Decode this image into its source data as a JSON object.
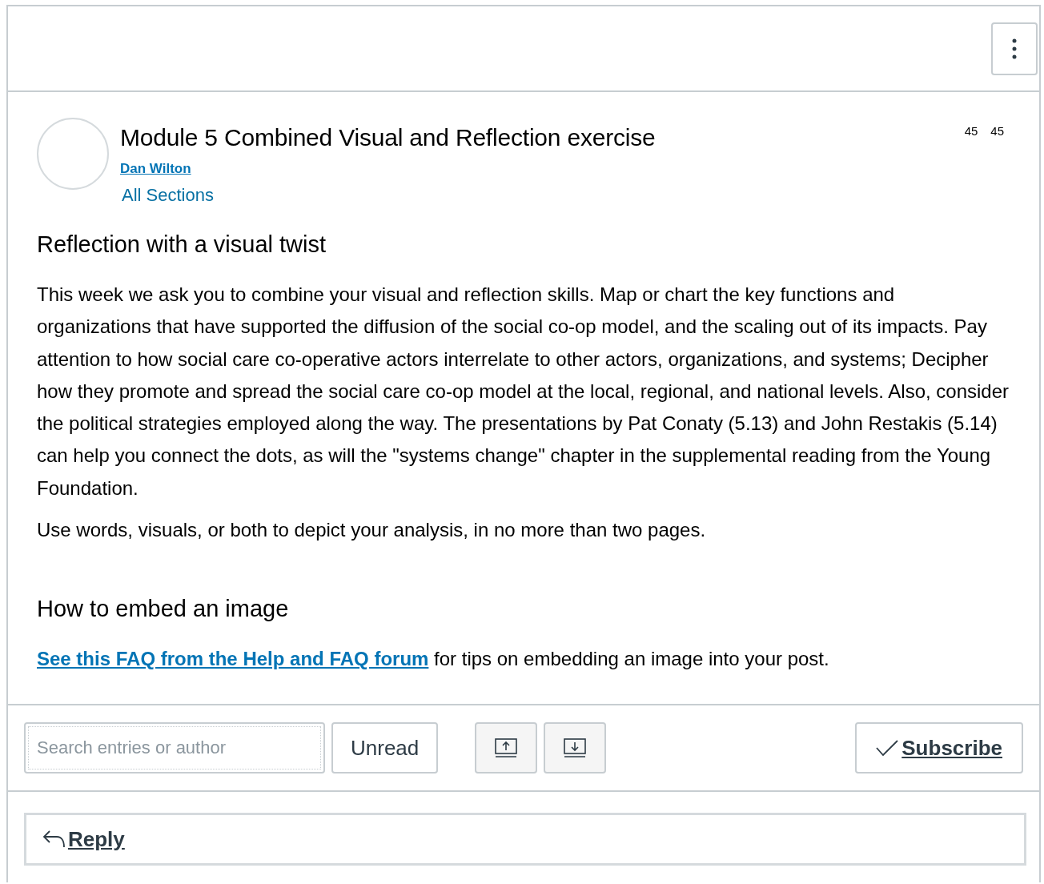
{
  "topic": {
    "title": "Module 5 Combined Visual and Reflection exercise",
    "author": "Dan Wilton",
    "sections": "All Sections",
    "counts": [
      "45",
      "45"
    ]
  },
  "body": {
    "heading": "Reflection with a visual twist",
    "paragraphs": [
      "This week we ask you to combine your visual and reflection skills. Map or chart the key functions and organizations that have supported the diffusion of the social co-op model, and the scaling out of its impacts. Pay attention to how social care co-operative actors interrelate to other actors, organizations, and systems; Decipher how they promote and spread the social care co-op model at the local, regional, and national levels. Also, consider the political strategies employed along the way. The presentations by Pat Conaty (5.13) and John Restakis (5.14) can help you connect the dots, as will the \"systems change\" chapter in the supplemental reading from the Young Foundation.",
      "Use words, visuals, or both to depict your analysis, in no more than two pages."
    ],
    "embed_heading": "How to embed an image",
    "embed_link": "See this FAQ from the Help and FAQ forum",
    "embed_text": " for tips on embedding an image into your post."
  },
  "toolbar": {
    "search": {
      "placeholder": "Search entries or author"
    },
    "unread": "Unread",
    "subscribe": {
      "label": "Subscribe",
      "subscribed": true
    }
  },
  "reply": {
    "label": "Reply"
  }
}
